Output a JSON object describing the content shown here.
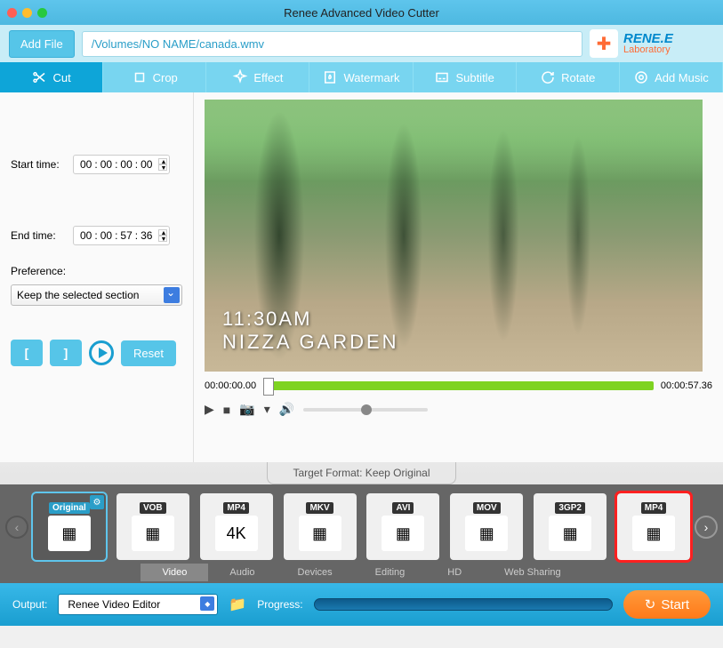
{
  "window": {
    "title": "Renee Advanced Video Cutter"
  },
  "toolbar": {
    "add_file": "Add File",
    "file_path": "/Volumes/NO NAME/canada.wmv",
    "brand_line1": "RENE.E",
    "brand_line2": "Laboratory"
  },
  "tabs": [
    {
      "label": "Cut"
    },
    {
      "label": "Crop"
    },
    {
      "label": "Effect"
    },
    {
      "label": "Watermark"
    },
    {
      "label": "Subtitle"
    },
    {
      "label": "Rotate"
    },
    {
      "label": "Add Music"
    }
  ],
  "sidebar": {
    "start_label": "Start time:",
    "end_label": "End time:",
    "start_time": {
      "h": "00",
      "m": "00",
      "s": "00",
      "ms": "00"
    },
    "end_time": {
      "h": "00",
      "m": "00",
      "s": "57",
      "ms": "36"
    },
    "pref_label": "Preference:",
    "pref_value": "Keep the selected section",
    "reset": "Reset"
  },
  "preview": {
    "overlay_time": "11:30AM",
    "overlay_place": "NIZZA GARDEN",
    "timeline_start": "00:00:00.00",
    "timeline_end": "00:00:57.36"
  },
  "target_format": {
    "label": "Target Format: Keep Original",
    "items": [
      {
        "name": "Original",
        "badge_bg": "#2a9ec8",
        "badge_fg": "#fff",
        "active": true
      },
      {
        "name": "VOB",
        "badge_bg": "#333",
        "badge_fg": "#fff"
      },
      {
        "name": "MP4",
        "badge_bg": "#333",
        "badge_fg": "#fff",
        "sub": "4K"
      },
      {
        "name": "MKV",
        "badge_bg": "#333",
        "badge_fg": "#fff"
      },
      {
        "name": "AVI",
        "badge_bg": "#333",
        "badge_fg": "#fff"
      },
      {
        "name": "MOV",
        "badge_bg": "#333",
        "badge_fg": "#fff"
      },
      {
        "name": "3GP2",
        "badge_bg": "#333",
        "badge_fg": "#fff"
      },
      {
        "name": "MP4",
        "badge_bg": "#333",
        "badge_fg": "#fff",
        "selected": true
      }
    ],
    "categories": [
      "Video",
      "Audio",
      "Devices",
      "Editing",
      "HD",
      "Web Sharing"
    ]
  },
  "footer": {
    "output_label": "Output:",
    "output_value": "Renee Video Editor",
    "progress_label": "Progress:",
    "start": "Start"
  }
}
